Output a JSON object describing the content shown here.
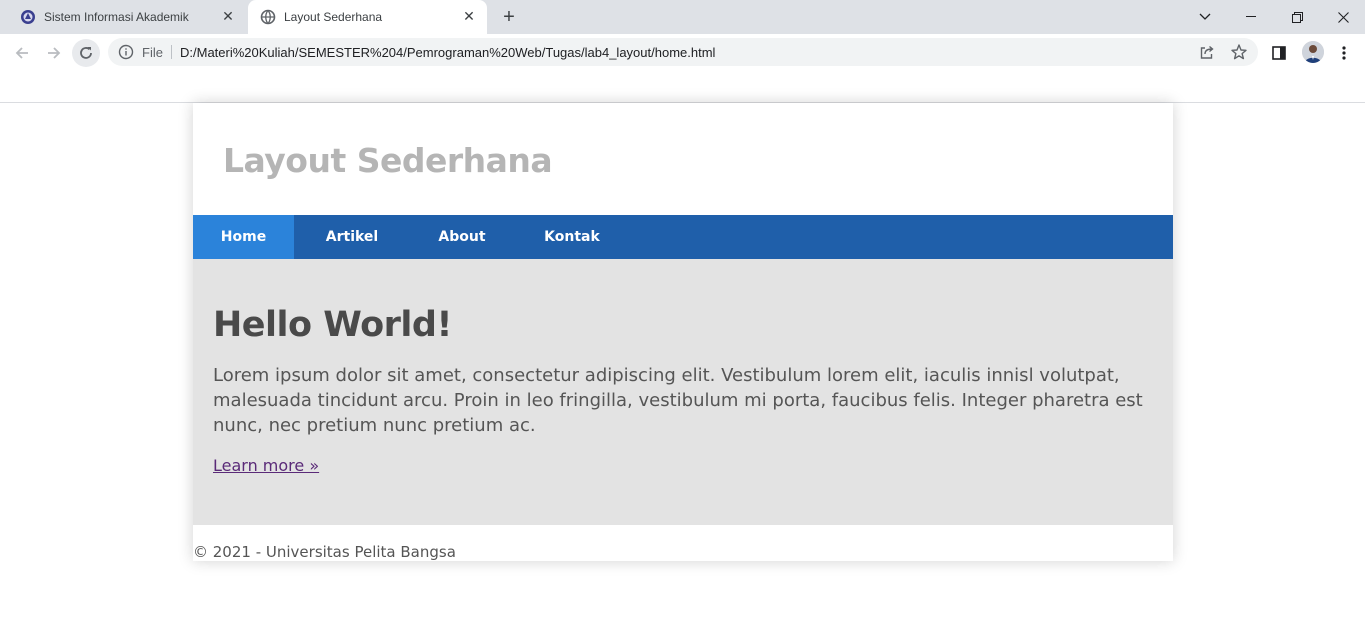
{
  "browser": {
    "tabs": [
      {
        "title": "Sistem Informasi Akademik",
        "icon": "university-logo-icon",
        "active": false
      },
      {
        "title": "Layout Sederhana",
        "icon": "globe-icon",
        "active": true
      }
    ],
    "omnibox": {
      "scheme_label": "File",
      "url": "D:/Materi%20Kuliah/SEMESTER%204/Pemrograman%20Web/Tugas/lab4_layout/home.html"
    }
  },
  "site": {
    "title": "Layout Sederhana",
    "nav": [
      {
        "label": "Home",
        "active": true
      },
      {
        "label": "Artikel",
        "active": false
      },
      {
        "label": "About",
        "active": false
      },
      {
        "label": "Kontak",
        "active": false
      }
    ],
    "hero": {
      "heading": "Hello World!",
      "body": "Lorem ipsum dolor sit amet, consectetur adipiscing elit. Vestibulum lorem elit, iaculis innisl volutpat, malesuada tincidunt arcu. Proin in leo fringilla, vestibulum mi porta, faucibus felis. Integer pharetra est nunc, nec pretium nunc pretium ac.",
      "link_label": "Learn more »"
    },
    "footer": "© 2021 - Universitas Pelita Bangsa"
  },
  "colors": {
    "nav_bg": "#1f5faa",
    "nav_active": "#2b83da",
    "hero_bg": "#e3e3e3",
    "title_gray": "#b5b5b5",
    "link_visited": "#5a2a78"
  }
}
